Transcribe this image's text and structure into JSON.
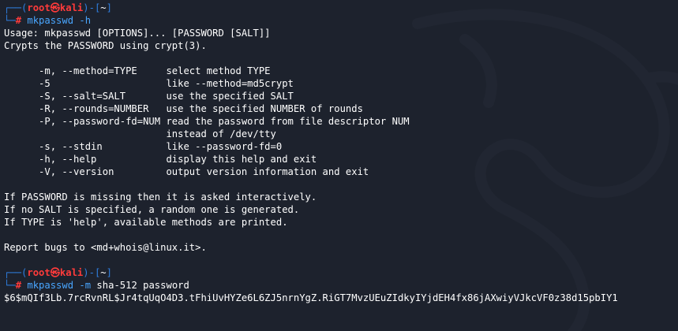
{
  "colors": {
    "background": "#1d222d",
    "prompt_frame": "#2f7fe0",
    "prompt_user": "#ff3b3b",
    "command": "#49a6ff",
    "output": "#ffffff"
  },
  "watermark": {
    "icon": "kali-dragon-icon"
  },
  "session1": {
    "prompt": {
      "frame_open": "┌──(",
      "user": "root",
      "at": "㉿",
      "host": "kali",
      "frame_mid": ")-[",
      "cwd": "~",
      "frame_close": "]",
      "line2_prefix": "└─",
      "hash": "#"
    },
    "command": " mkpasswd -h",
    "output": [
      "Usage: mkpasswd [OPTIONS]... [PASSWORD [SALT]]",
      "Crypts the PASSWORD using crypt(3).",
      "",
      "      -m, --method=TYPE     select method TYPE",
      "      -5                    like --method=md5crypt",
      "      -S, --salt=SALT       use the specified SALT",
      "      -R, --rounds=NUMBER   use the specified NUMBER of rounds",
      "      -P, --password-fd=NUM read the password from file descriptor NUM",
      "                            instead of /dev/tty",
      "      -s, --stdin           like --password-fd=0",
      "      -h, --help            display this help and exit",
      "      -V, --version         output version information and exit",
      "",
      "If PASSWORD is missing then it is asked interactively.",
      "If no SALT is specified, a random one is generated.",
      "If TYPE is 'help', available methods are printed.",
      "",
      "Report bugs to <md+whois@linux.it>.",
      ""
    ]
  },
  "session2": {
    "prompt": {
      "frame_open": "┌──(",
      "user": "root",
      "at": "㉿",
      "host": "kali",
      "frame_mid": ")-[",
      "cwd": "~",
      "frame_close": "]",
      "line2_prefix": "└─",
      "hash": "#"
    },
    "command_name": " mkpasswd",
    "command_flag": " -m",
    "command_args": " sha-512 password",
    "output": [
      "$6$mQIf3Lb.7rcRvnRL$Jr4tqUqO4D3.tFhiUvHYZe6L6ZJ5nrnYgZ.RiGT7MvzUEuZIdkyIYjdEH4fx86jAXwiyVJkcVF0z38d15pbIY1"
    ]
  }
}
